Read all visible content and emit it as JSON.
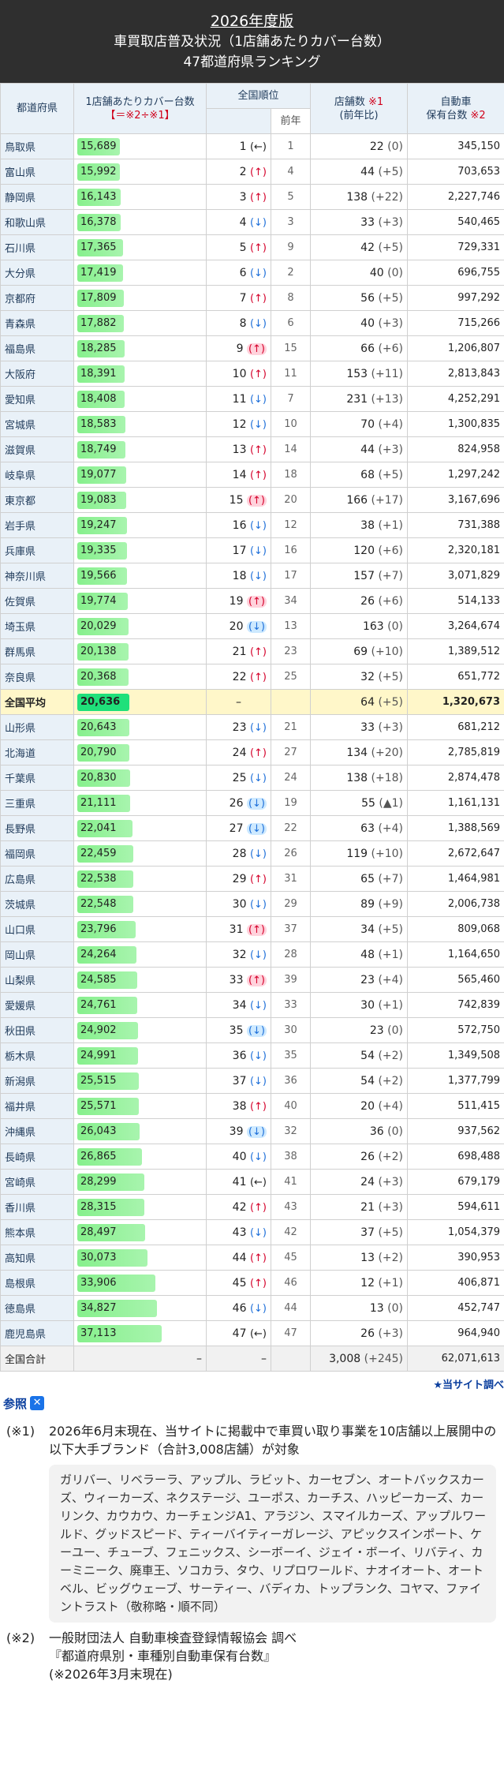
{
  "title": {
    "line1": "2026年度版",
    "line2": "車買取店普及状況（1店舗あたりカバー台数）",
    "line3": "47都道府県ランキング"
  },
  "header": {
    "pref": "都道府県",
    "coverage": "1店舗あたりカバー台数",
    "coverage_formula": "【＝※2÷※1】",
    "rank": "全国順位",
    "prev": "前年",
    "stores": "店舗数",
    "stores_note": "※1",
    "stores_sub": "(前年比)",
    "cars": "自動車",
    "cars_line2": "保有台数",
    "cars_note": "※2"
  },
  "rows": [
    {
      "pref": "鳥取県",
      "cov": "15,689",
      "rank": "1",
      "dir": "←",
      "cls": "flat",
      "prev": "1",
      "stores": "22",
      "delta": "(0)",
      "cars": "345,150"
    },
    {
      "pref": "富山県",
      "cov": "15,992",
      "rank": "2",
      "dir": "↑",
      "cls": "up",
      "prev": "4",
      "stores": "44",
      "delta": "(+5)",
      "cars": "703,653"
    },
    {
      "pref": "静岡県",
      "cov": "16,143",
      "rank": "3",
      "dir": "↑",
      "cls": "up",
      "prev": "5",
      "stores": "138",
      "delta": "(+22)",
      "cars": "2,227,746"
    },
    {
      "pref": "和歌山県",
      "cov": "16,378",
      "rank": "4",
      "dir": "↓",
      "cls": "down",
      "prev": "3",
      "stores": "33",
      "delta": "(+3)",
      "cars": "540,465"
    },
    {
      "pref": "石川県",
      "cov": "17,365",
      "rank": "5",
      "dir": "↑",
      "cls": "up",
      "prev": "9",
      "stores": "42",
      "delta": "(+5)",
      "cars": "729,331"
    },
    {
      "pref": "大分県",
      "cov": "17,419",
      "rank": "6",
      "dir": "↓",
      "cls": "down",
      "prev": "2",
      "stores": "40",
      "delta": "(0)",
      "cars": "696,755"
    },
    {
      "pref": "京都府",
      "cov": "17,809",
      "rank": "7",
      "dir": "↑",
      "cls": "up",
      "prev": "8",
      "stores": "56",
      "delta": "(+5)",
      "cars": "997,292"
    },
    {
      "pref": "青森県",
      "cov": "17,882",
      "rank": "8",
      "dir": "↓",
      "cls": "down",
      "prev": "6",
      "stores": "40",
      "delta": "(+3)",
      "cars": "715,266"
    },
    {
      "pref": "福島県",
      "cov": "18,285",
      "rank": "9",
      "dir": "↑",
      "cls": "up bgup",
      "prev": "15",
      "stores": "66",
      "delta": "(+6)",
      "cars": "1,206,807"
    },
    {
      "pref": "大阪府",
      "cov": "18,391",
      "rank": "10",
      "dir": "↑",
      "cls": "up",
      "prev": "11",
      "stores": "153",
      "delta": "(+11)",
      "cars": "2,813,843"
    },
    {
      "pref": "愛知県",
      "cov": "18,408",
      "rank": "11",
      "dir": "↓",
      "cls": "down",
      "prev": "7",
      "stores": "231",
      "delta": "(+13)",
      "cars": "4,252,291"
    },
    {
      "pref": "宮城県",
      "cov": "18,583",
      "rank": "12",
      "dir": "↓",
      "cls": "down",
      "prev": "10",
      "stores": "70",
      "delta": "(+4)",
      "cars": "1,300,835"
    },
    {
      "pref": "滋賀県",
      "cov": "18,749",
      "rank": "13",
      "dir": "↑",
      "cls": "up",
      "prev": "14",
      "stores": "44",
      "delta": "(+3)",
      "cars": "824,958"
    },
    {
      "pref": "岐阜県",
      "cov": "19,077",
      "rank": "14",
      "dir": "↑",
      "cls": "up",
      "prev": "18",
      "stores": "68",
      "delta": "(+5)",
      "cars": "1,297,242"
    },
    {
      "pref": "東京都",
      "cov": "19,083",
      "rank": "15",
      "dir": "↑",
      "cls": "up bgup",
      "prev": "20",
      "stores": "166",
      "delta": "(+17)",
      "cars": "3,167,696"
    },
    {
      "pref": "岩手県",
      "cov": "19,247",
      "rank": "16",
      "dir": "↓",
      "cls": "down",
      "prev": "12",
      "stores": "38",
      "delta": "(+1)",
      "cars": "731,388"
    },
    {
      "pref": "兵庫県",
      "cov": "19,335",
      "rank": "17",
      "dir": "↓",
      "cls": "down",
      "prev": "16",
      "stores": "120",
      "delta": "(+6)",
      "cars": "2,320,181"
    },
    {
      "pref": "神奈川県",
      "cov": "19,566",
      "rank": "18",
      "dir": "↓",
      "cls": "down",
      "prev": "17",
      "stores": "157",
      "delta": "(+7)",
      "cars": "3,071,829"
    },
    {
      "pref": "佐賀県",
      "cov": "19,774",
      "rank": "19",
      "dir": "↑",
      "cls": "up bgup",
      "prev": "34",
      "stores": "26",
      "delta": "(+6)",
      "cars": "514,133"
    },
    {
      "pref": "埼玉県",
      "cov": "20,029",
      "rank": "20",
      "dir": "↓",
      "cls": "down bgdown",
      "prev": "13",
      "stores": "163",
      "delta": "(0)",
      "cars": "3,264,674"
    },
    {
      "pref": "群馬県",
      "cov": "20,138",
      "rank": "21",
      "dir": "↑",
      "cls": "up",
      "prev": "23",
      "stores": "69",
      "delta": "(+10)",
      "cars": "1,389,512"
    },
    {
      "pref": "奈良県",
      "cov": "20,368",
      "rank": "22",
      "dir": "↑",
      "cls": "up",
      "prev": "25",
      "stores": "32",
      "delta": "(+5)",
      "cars": "651,772"
    },
    {
      "pref": "全国平均",
      "cov": "20,636",
      "rank": "–",
      "dir": "",
      "cls": "",
      "prev": "",
      "stores": "64",
      "delta": "(+5)",
      "cars": "1,320,673",
      "avg": true
    },
    {
      "pref": "山形県",
      "cov": "20,643",
      "rank": "23",
      "dir": "↓",
      "cls": "down",
      "prev": "21",
      "stores": "33",
      "delta": "(+3)",
      "cars": "681,212"
    },
    {
      "pref": "北海道",
      "cov": "20,790",
      "rank": "24",
      "dir": "↑",
      "cls": "up",
      "prev": "27",
      "stores": "134",
      "delta": "(+20)",
      "cars": "2,785,819"
    },
    {
      "pref": "千葉県",
      "cov": "20,830",
      "rank": "25",
      "dir": "↓",
      "cls": "down",
      "prev": "24",
      "stores": "138",
      "delta": "(+18)",
      "cars": "2,874,478"
    },
    {
      "pref": "三重県",
      "cov": "21,111",
      "rank": "26",
      "dir": "↓",
      "cls": "down bgdown",
      "prev": "19",
      "stores": "55",
      "delta": "(▲1)",
      "cars": "1,161,131"
    },
    {
      "pref": "長野県",
      "cov": "22,041",
      "rank": "27",
      "dir": "↓",
      "cls": "down bgdown",
      "prev": "22",
      "stores": "63",
      "delta": "(+4)",
      "cars": "1,388,569"
    },
    {
      "pref": "福岡県",
      "cov": "22,459",
      "rank": "28",
      "dir": "↓",
      "cls": "down",
      "prev": "26",
      "stores": "119",
      "delta": "(+10)",
      "cars": "2,672,647"
    },
    {
      "pref": "広島県",
      "cov": "22,538",
      "rank": "29",
      "dir": "↑",
      "cls": "up",
      "prev": "31",
      "stores": "65",
      "delta": "(+7)",
      "cars": "1,464,981"
    },
    {
      "pref": "茨城県",
      "cov": "22,548",
      "rank": "30",
      "dir": "↓",
      "cls": "down",
      "prev": "29",
      "stores": "89",
      "delta": "(+9)",
      "cars": "2,006,738"
    },
    {
      "pref": "山口県",
      "cov": "23,796",
      "rank": "31",
      "dir": "↑",
      "cls": "up bgup",
      "prev": "37",
      "stores": "34",
      "delta": "(+5)",
      "cars": "809,068"
    },
    {
      "pref": "岡山県",
      "cov": "24,264",
      "rank": "32",
      "dir": "↓",
      "cls": "down",
      "prev": "28",
      "stores": "48",
      "delta": "(+1)",
      "cars": "1,164,650"
    },
    {
      "pref": "山梨県",
      "cov": "24,585",
      "rank": "33",
      "dir": "↑",
      "cls": "up bgup",
      "prev": "39",
      "stores": "23",
      "delta": "(+4)",
      "cars": "565,460"
    },
    {
      "pref": "愛媛県",
      "cov": "24,761",
      "rank": "34",
      "dir": "↓",
      "cls": "down",
      "prev": "33",
      "stores": "30",
      "delta": "(+1)",
      "cars": "742,839"
    },
    {
      "pref": "秋田県",
      "cov": "24,902",
      "rank": "35",
      "dir": "↓",
      "cls": "down bgdown",
      "prev": "30",
      "stores": "23",
      "delta": "(0)",
      "cars": "572,750"
    },
    {
      "pref": "栃木県",
      "cov": "24,991",
      "rank": "36",
      "dir": "↓",
      "cls": "down",
      "prev": "35",
      "stores": "54",
      "delta": "(+2)",
      "cars": "1,349,508"
    },
    {
      "pref": "新潟県",
      "cov": "25,515",
      "rank": "37",
      "dir": "↓",
      "cls": "down",
      "prev": "36",
      "stores": "54",
      "delta": "(+2)",
      "cars": "1,377,799"
    },
    {
      "pref": "福井県",
      "cov": "25,571",
      "rank": "38",
      "dir": "↑",
      "cls": "up",
      "prev": "40",
      "stores": "20",
      "delta": "(+4)",
      "cars": "511,415"
    },
    {
      "pref": "沖縄県",
      "cov": "26,043",
      "rank": "39",
      "dir": "↓",
      "cls": "down bgdown",
      "prev": "32",
      "stores": "36",
      "delta": "(0)",
      "cars": "937,562"
    },
    {
      "pref": "長崎県",
      "cov": "26,865",
      "rank": "40",
      "dir": "↓",
      "cls": "down",
      "prev": "38",
      "stores": "26",
      "delta": "(+2)",
      "cars": "698,488"
    },
    {
      "pref": "宮崎県",
      "cov": "28,299",
      "rank": "41",
      "dir": "←",
      "cls": "flat",
      "prev": "41",
      "stores": "24",
      "delta": "(+3)",
      "cars": "679,179"
    },
    {
      "pref": "香川県",
      "cov": "28,315",
      "rank": "42",
      "dir": "↑",
      "cls": "up",
      "prev": "43",
      "stores": "21",
      "delta": "(+3)",
      "cars": "594,611"
    },
    {
      "pref": "熊本県",
      "cov": "28,497",
      "rank": "43",
      "dir": "↓",
      "cls": "down",
      "prev": "42",
      "stores": "37",
      "delta": "(+5)",
      "cars": "1,054,379"
    },
    {
      "pref": "高知県",
      "cov": "30,073",
      "rank": "44",
      "dir": "↑",
      "cls": "up",
      "prev": "45",
      "stores": "13",
      "delta": "(+2)",
      "cars": "390,953"
    },
    {
      "pref": "島根県",
      "cov": "33,906",
      "rank": "45",
      "dir": "↑",
      "cls": "up",
      "prev": "46",
      "stores": "12",
      "delta": "(+1)",
      "cars": "406,871"
    },
    {
      "pref": "徳島県",
      "cov": "34,827",
      "rank": "46",
      "dir": "↓",
      "cls": "down",
      "prev": "44",
      "stores": "13",
      "delta": "(0)",
      "cars": "452,747"
    },
    {
      "pref": "鹿児島県",
      "cov": "37,113",
      "rank": "47",
      "dir": "←",
      "cls": "flat",
      "prev": "47",
      "stores": "26",
      "delta": "(+3)",
      "cars": "964,940"
    }
  ],
  "total": {
    "pref": "全国合計",
    "cov": "–",
    "rank": "–",
    "stores": "3,008",
    "delta": "(+245)",
    "cars": "62,071,613"
  },
  "source_link": "★当サイト調べ",
  "ref": {
    "title": "参照",
    "close": "✕"
  },
  "note1": {
    "mark": "(※1)",
    "text": "2026年6月末現在、当サイトに掲載中で車買い取り事業を10店舗以上展開中の以下大手ブランド（合計3,008店舗）が対象",
    "brands": "ガリバー、リベラーラ、アップル、ラビット、カーセブン、オートバックスカーズ、ウィーカーズ、ネクステージ、ユーポス、カーチス、ハッピーカーズ、カーリンク、カウカウ、カーチェンジA1、アラジン、スマイルカーズ、アップルワールド、グッドスピード、ティーバイティーガレージ、アピックスインポート、ケーユー、チューブ、フェニックス、シーボーイ、ジェイ・ボーイ、リバティ、カーミニーク、廃車王、ソコカラ、タウ、リプロワールド、ナオイオート、オートベル、ビッグウェーブ、サーティー、バディカ、トップランク、コヤマ、ファイントラスト（敬称略・順不同）"
  },
  "note2": {
    "mark": "(※2)",
    "line1": "一般財団法人 自動車検査登録情報協会 調べ",
    "line2": "『都道府県別・車種別自動車保有台数』",
    "line3": "(※2026年3月末現在)"
  },
  "colors": {
    "title_bg": "#2f2f2f",
    "bar": "#86f08c",
    "avg_bar": "#1fe07a",
    "up": "#d4002a",
    "down": "#1e6fd9"
  }
}
